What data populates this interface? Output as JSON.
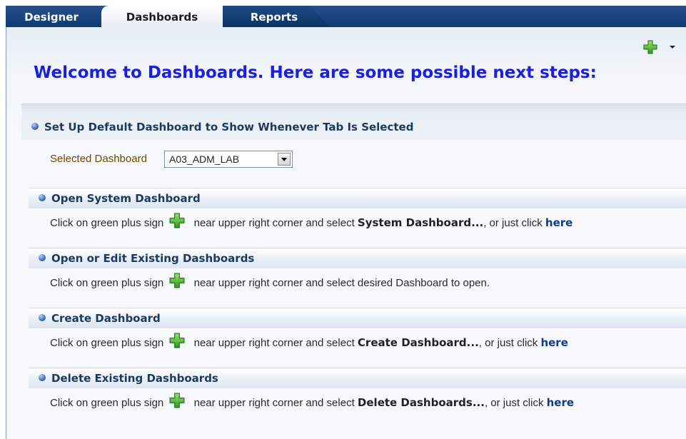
{
  "tabs": [
    {
      "label": "Designer"
    },
    {
      "label": "Dashboards"
    },
    {
      "label": "Reports"
    }
  ],
  "welcome": "Welcome to Dashboards.  Here are some possible next steps:",
  "default_section": {
    "title": "Set Up Default Dashboard to Show Whenever Tab Is Selected",
    "label": "Selected Dashboard",
    "value": "A03_ADM_LAB"
  },
  "sections": [
    {
      "title": "Open System Dashboard",
      "pre": "Click on green plus sign",
      "mid": "near upper right corner and select",
      "bold": "System Dashboard...",
      "post": ", or just click",
      "link": "here"
    },
    {
      "title": "Open or Edit Existing Dashboards",
      "pre": "Click on green plus sign",
      "mid": "near upper right corner and select desired Dashboard to open."
    },
    {
      "title": "Create Dashboard",
      "pre": "Click on green plus sign",
      "mid": "near upper right corner and select",
      "bold": "Create Dashboard...",
      "post": ", or just click",
      "link": "here"
    },
    {
      "title": "Delete Existing Dashboards",
      "pre": "Click on green plus sign",
      "mid": "near upper right corner and select",
      "bold": "Delete Dashboards...",
      "post": ", or just click",
      "link": "here"
    }
  ],
  "icons": {
    "add": "green-plus-icon",
    "menu": "dropdown-caret-icon",
    "bullet": "blue-bullet-icon"
  },
  "colors": {
    "tabbar": "#0e3a73",
    "welcome": "#1a1ee0",
    "plus": "#3aa52a",
    "link": "#123b8a"
  }
}
